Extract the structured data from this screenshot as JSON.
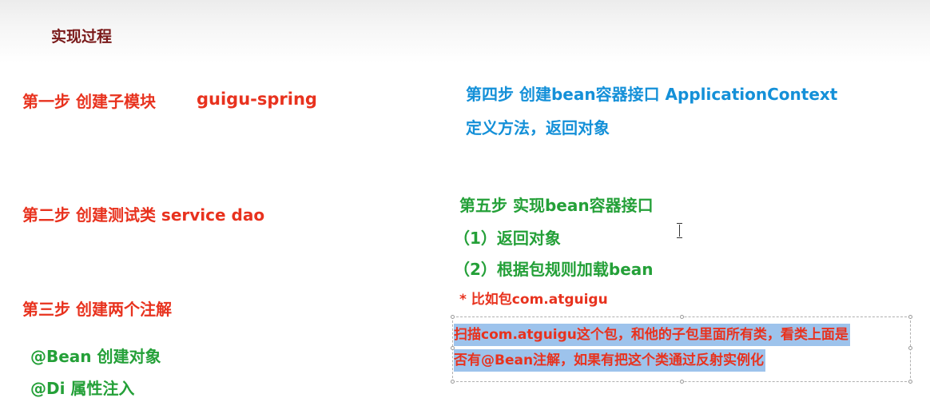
{
  "title": "实现过程",
  "steps": {
    "step1": {
      "label": "第一步 创建子模块",
      "detail": "guigu-spring"
    },
    "step2": {
      "label": "第二步 创建测试类 service  dao"
    },
    "step3": {
      "label": "第三步 创建两个注解",
      "items": [
        "@Bean  创建对象",
        "@Di  属性注入"
      ]
    },
    "step4": {
      "label": "第四步 创建bean容器接口 ApplicationContext",
      "sub": "定义方法，返回对象"
    },
    "step5": {
      "label": "第五步 实现bean容器接口",
      "items": [
        "（1）返回对象",
        "（2）根据包规则加载bean"
      ],
      "example": "* 比如包com.atguigu",
      "highlight_lines": [
        "扫描com.atguigu这个包，和他的子包里面所有类，看类上面是",
        "否有@Bean注解，如果有把这个类通过反射实例化"
      ]
    }
  },
  "colors": {
    "title": "#7a1a1a",
    "red": "#e8321e",
    "blue": "#1490d8",
    "green": "#24a038",
    "highlight": "#9dc3ec"
  }
}
